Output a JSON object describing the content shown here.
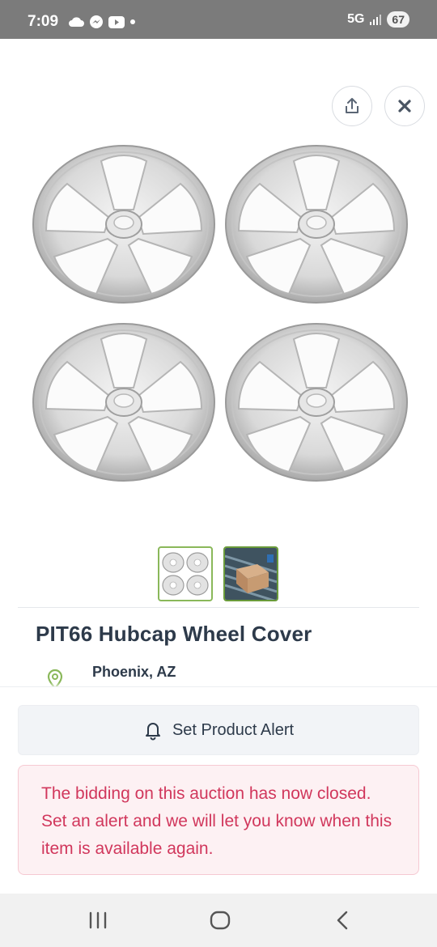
{
  "status_bar": {
    "time": "7:09",
    "network": "5G",
    "battery": "67",
    "icons": [
      "cloud-icon",
      "messenger-icon",
      "youtube-icon",
      "dot-icon"
    ]
  },
  "header": {
    "share_icon": "share-icon",
    "close_icon": "close-icon"
  },
  "product": {
    "title": "PIT66 Hubcap Wheel Cover",
    "location": "Phoenix, AZ",
    "thumbnails": [
      "hubcap-set-thumbnail",
      "boxed-item-thumbnail"
    ]
  },
  "actions": {
    "set_alert_label": "Set Product Alert"
  },
  "notice": {
    "closed_text": "The bidding on this auction has now closed. Set an alert and we will let you know when this item is available again."
  },
  "colors": {
    "title": "#2d3a4a",
    "notice_text": "#d1375c",
    "notice_bg": "#fdf1f3",
    "accent_green": "#8ab85a"
  }
}
